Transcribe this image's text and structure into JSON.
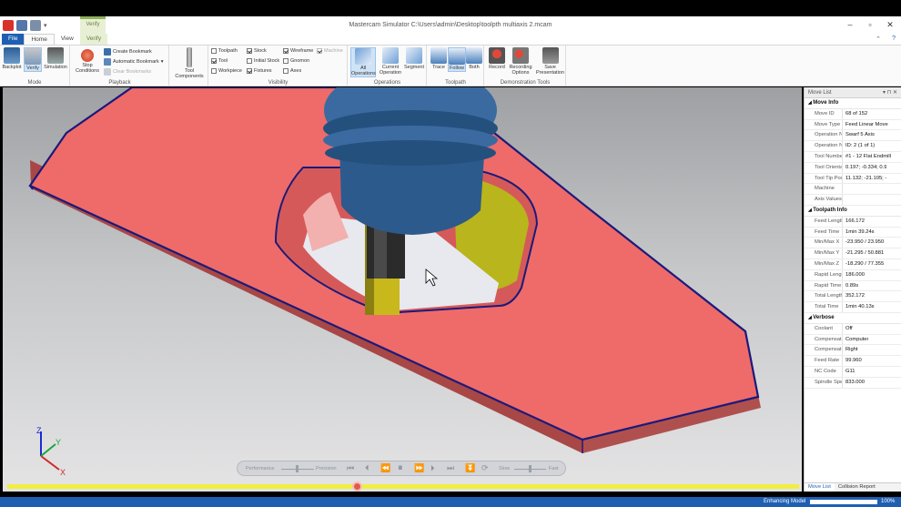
{
  "window": {
    "title": "Mastercam Simulator  C:\\Users\\admin\\Desktop\\toolpth multiaxis 2.mcam",
    "contextual_tab_group": "Verify"
  },
  "tabs": [
    "File",
    "Home",
    "View",
    "Verify"
  ],
  "ribbon": {
    "mode": {
      "label": "Mode",
      "buttons": [
        "Backplot",
        "Verify",
        "Simulation"
      ]
    },
    "playback": {
      "label": "Playback",
      "stop_conditions": "Stop Conditions",
      "create_bookmark": "Create Bookmark",
      "automatic_bookmark": "Automatic Bookmark",
      "clear_bookmarks": "Clear Bookmarks"
    },
    "tool_components": "Tool Components",
    "visibility": {
      "label": "Visibility",
      "items": [
        {
          "text": "Toolpath",
          "checked": false
        },
        {
          "text": "Tool",
          "checked": true
        },
        {
          "text": "Workpiece",
          "checked": false
        },
        {
          "text": "Stock",
          "checked": true
        },
        {
          "text": "Initial Stock",
          "checked": false
        },
        {
          "text": "Fixtures",
          "checked": true
        },
        {
          "text": "Wireframe",
          "checked": true
        },
        {
          "text": "Gnomon",
          "checked": false
        },
        {
          "text": "Axes",
          "checked": false
        },
        {
          "text": "Machine",
          "checked": true
        }
      ]
    },
    "operations": {
      "label": "Operations",
      "buttons": [
        "All Operations",
        "Current Operation",
        "Segment"
      ]
    },
    "toolpath": {
      "label": "Toolpath",
      "buttons": [
        "Trace",
        "Follow",
        "Both"
      ]
    },
    "demo": {
      "label": "Demonstration Tools",
      "buttons": [
        "Record",
        "Recording Options",
        "Save Presentation"
      ]
    }
  },
  "move_list": {
    "title": "Move List",
    "sections": [
      {
        "name": "Move Info",
        "rows": [
          [
            "Move ID",
            "68 of 152"
          ],
          [
            "Move Type",
            "Feed Linear Move"
          ],
          [
            "Operation Na",
            "Swarf 5 Axis"
          ],
          [
            "Operation Nu",
            "ID: 2 (1 of 1)"
          ],
          [
            "Tool Number",
            "#1 - 12 Flat Endmill"
          ],
          [
            "Tool Orientati",
            "0.197; -0.334; 0.9"
          ],
          [
            "Tool Tip Posit",
            "11.132; -21.105; -"
          ],
          [
            "Machine",
            ""
          ],
          [
            "Axis Values",
            ""
          ]
        ]
      },
      {
        "name": "Toolpath Info",
        "rows": [
          [
            "Feed Length",
            "166.172"
          ],
          [
            "Feed Time",
            "1min 39.24s"
          ],
          [
            "Min/Max X",
            "-23.950 / 23.950"
          ],
          [
            "Min/Max Y",
            "-21.295 / 50.881"
          ],
          [
            "Min/Max Z",
            "-18.290 / 77.355"
          ],
          [
            "Rapid Length",
            "186.000"
          ],
          [
            "Rapid Time",
            "0.89s"
          ],
          [
            "Total Length",
            "352.172"
          ],
          [
            "Total Time",
            "1min 40.13s"
          ]
        ]
      },
      {
        "name": "Verbose",
        "rows": [
          [
            "Coolant",
            "Off"
          ],
          [
            "Compensation",
            "Computer"
          ],
          [
            "Compensation",
            "Right"
          ],
          [
            "Feed Rate",
            "99.960"
          ],
          [
            "NC Code",
            "G11"
          ],
          [
            "Spindle Speed",
            "833.000"
          ]
        ]
      }
    ],
    "tabs": [
      "Move List",
      "Collision Report"
    ]
  },
  "playbar": {
    "performance": "Performance",
    "precision": "Precision",
    "slow": "Slow",
    "fast": "Fast"
  },
  "timeline": {
    "progress": 0.45
  },
  "status": {
    "text": "Enhancing Model",
    "percent": "100%",
    "progress": 1.0
  },
  "gnomon": {
    "x": "X",
    "y": "Y",
    "z": "Z"
  },
  "colors": {
    "brand": "#1f5fb2",
    "stock": "#ee6b6a",
    "tool_holder": "#2d5a8c",
    "tool": "#c8b81c",
    "timeline": "#f2ee40"
  }
}
